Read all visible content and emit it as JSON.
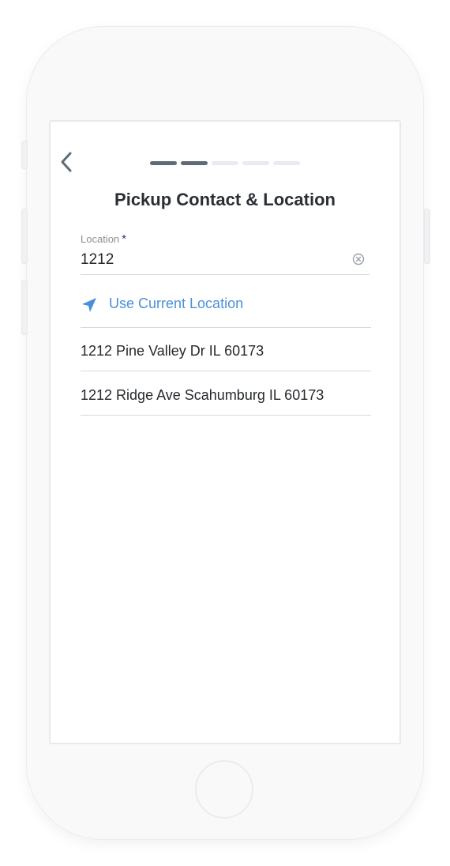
{
  "header": {
    "title": "Pickup Contact & Location",
    "progress": {
      "total_steps": 5,
      "completed_steps": 2
    }
  },
  "location_field": {
    "label": "Location",
    "required_marker": "*",
    "value": "1212"
  },
  "use_current_location": {
    "label": "Use Current Location",
    "icon": "navigation-arrow-icon"
  },
  "suggestions": [
    {
      "text": "1212 Pine Valley Dr IL 60173"
    },
    {
      "text": "1212 Ridge Ave Scahumburg IL 60173"
    }
  ],
  "colors": {
    "accent": "#4a90d9",
    "progress_active": "#5f6b75",
    "progress_inactive": "#e8ecf0",
    "required_marker": "#4a2e7e",
    "text_primary": "#25292d"
  }
}
